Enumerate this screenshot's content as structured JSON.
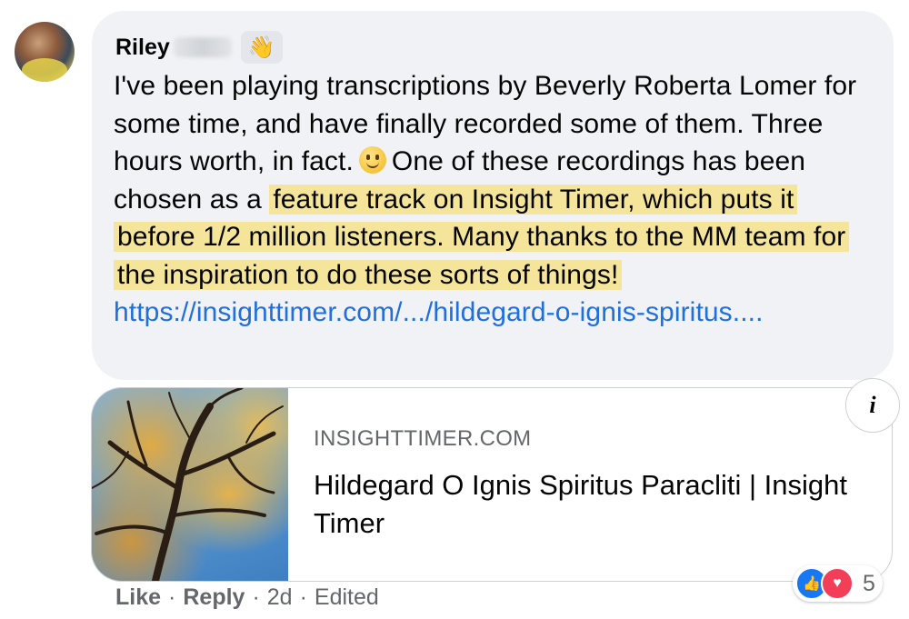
{
  "comment": {
    "author": "Riley",
    "badge_icon": "wave-hand-icon",
    "text_segments": {
      "plain1": "I've been playing transcriptions by Beverly Roberta Lomer for some time, and have finally recorded some of them. Three hours worth, in fact.",
      "emoji": "slightly-smiling-face-icon",
      "plain2": "One of these recordings has been chosen as a",
      "highlighted": "feature track on Insight Timer, which puts it before 1/2 million listeners. Many thanks to the MM team for the inspiration to do these sorts of things!"
    },
    "link": "https://insighttimer.com/.../hildegard-o-ignis-spiritus...."
  },
  "link_preview": {
    "domain": "INSIGHTTIMER.COM",
    "title": "Hildegard O Ignis Spiritus Paracliti | Insight Timer",
    "info_label": "i"
  },
  "actions": {
    "like": "Like",
    "reply": "Reply",
    "separator": "·",
    "time": "2d",
    "edited": "Edited"
  },
  "reactions": {
    "count": "5",
    "types": [
      "like-reaction-icon",
      "love-reaction-icon"
    ]
  },
  "colors": {
    "bubble_bg": "#f0f2f5",
    "highlight": "#f4e59a",
    "link": "#216fdb",
    "meta_text": "#65676b"
  }
}
